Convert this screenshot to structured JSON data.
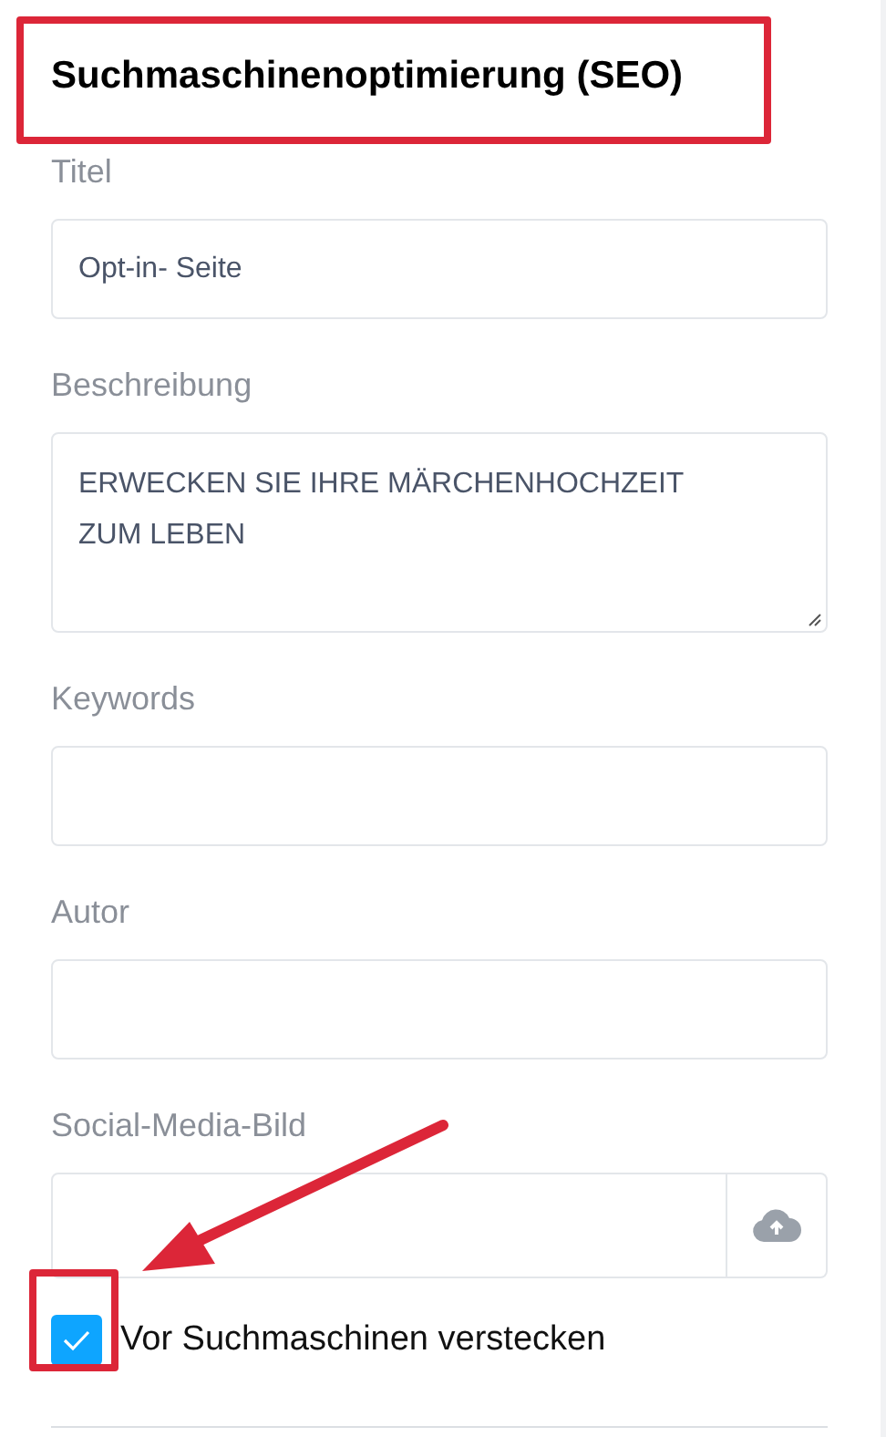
{
  "section": {
    "title": "Suchmaschinenoptimierung (SEO)"
  },
  "fields": [
    {
      "kind": "text",
      "label": "Titel",
      "value": "Opt-in- Seite"
    },
    {
      "kind": "textarea",
      "label": "Beschreibung",
      "value": "ERWECKEN SIE IHRE MÄRCHENHOCHZEIT ZUM LEBEN"
    },
    {
      "kind": "text",
      "label": "Keywords"
    },
    {
      "kind": "text",
      "label": "Autor"
    },
    {
      "kind": "file",
      "label": "Social-Media-Bild"
    }
  ],
  "hide_checkbox": {
    "label": "Vor Suchmaschinen verstecken",
    "checked": true
  }
}
